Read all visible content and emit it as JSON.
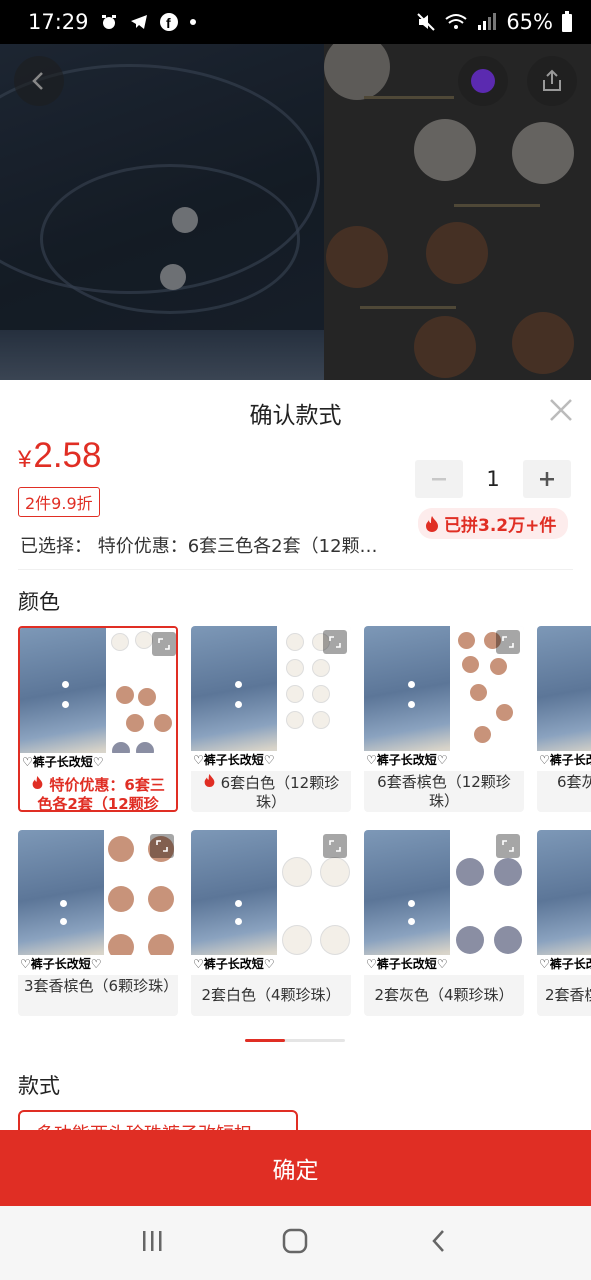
{
  "status_bar": {
    "time": "17:29",
    "battery": "65%"
  },
  "sheet": {
    "title": "确认款式",
    "price_currency": "¥",
    "price_value": "2.58",
    "discount_badge": "2件9.9折",
    "quantity": "1",
    "sold_text": "已拼3.2万+件",
    "selected_text": "已选择：  特价优惠：6套三色各2套（12颗…",
    "color_section_label": "颜色",
    "style_section_label": "款式",
    "style_option": "多功能两头珍珠裤子改短扣"
  },
  "color_options": [
    {
      "label": "特价优惠：6套三色各2套（12颗珍",
      "caption": "♡裤子长改短♡",
      "hot": true,
      "selected": true
    },
    {
      "label": "6套白色（12颗珍珠）",
      "caption": "♡裤子长改短♡",
      "hot": true,
      "selected": false
    },
    {
      "label": "6套香槟色（12颗珍珠）",
      "caption": "♡裤子长改短♡",
      "hot": false,
      "selected": false
    },
    {
      "label": "6套灰",
      "caption": "♡裤子长改",
      "hot": false,
      "selected": false
    },
    {
      "label": "3套香槟色（6颗珍珠）",
      "caption": "♡裤子长改短♡",
      "hot": false,
      "selected": false
    },
    {
      "label": "2套白色（4颗珍珠）",
      "caption": "♡裤子长改短♡",
      "hot": false,
      "selected": false
    },
    {
      "label": "2套灰色（4颗珍珠）",
      "caption": "♡裤子长改短♡",
      "hot": false,
      "selected": false
    },
    {
      "label": "2套香槟",
      "caption": "♡裤子长改",
      "hot": false,
      "selected": false
    }
  ],
  "confirm_button": "确定",
  "colors": {
    "accent": "#e02e24",
    "champagne": "#c8937a",
    "white_pearl": "#f3efe8",
    "gray_pearl": "#8a8ea3"
  }
}
